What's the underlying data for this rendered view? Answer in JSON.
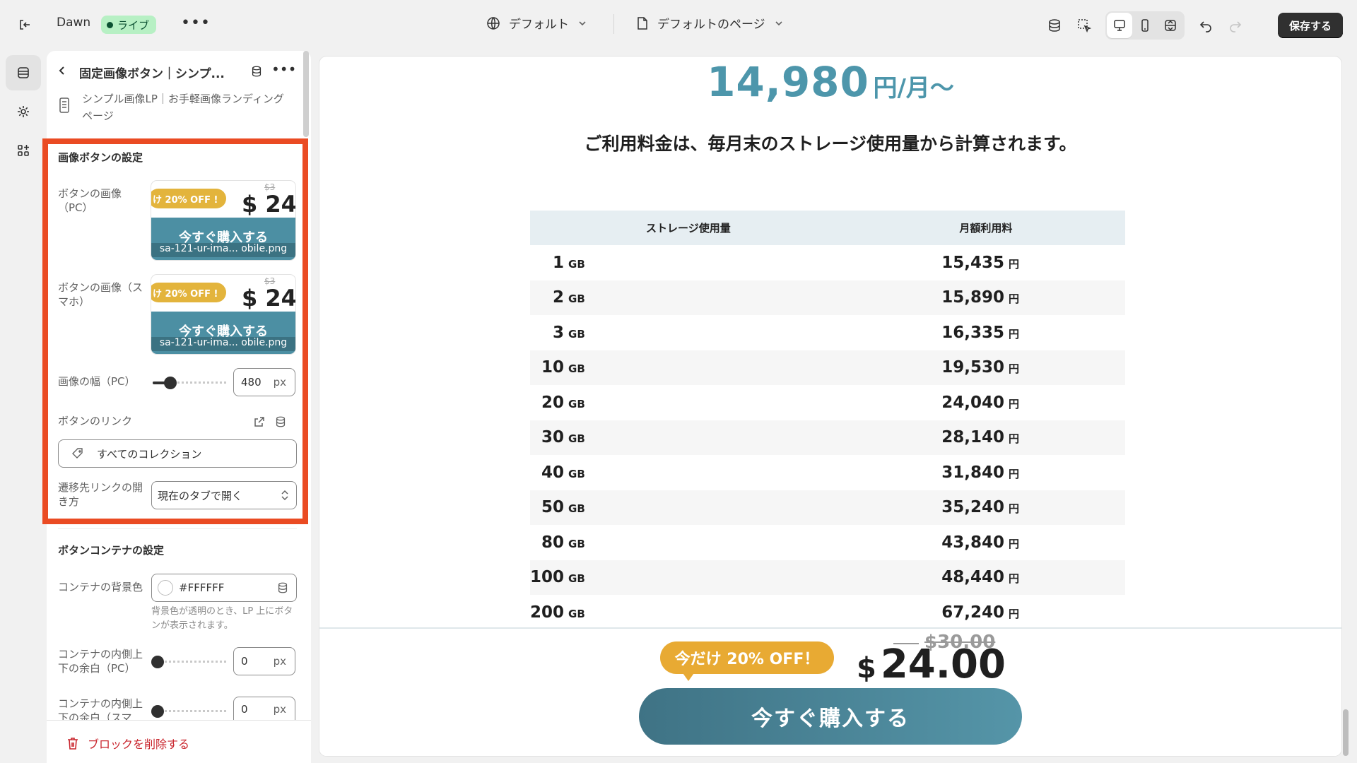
{
  "topbar": {
    "store_name": "Dawn",
    "live_badge": "ライブ",
    "more": "•••",
    "theme_label": "デフォルト",
    "page_label": "デフォルトのページ",
    "save_label": "保存する"
  },
  "panel": {
    "title": "固定画像ボタン｜シンプ...",
    "subtitle": "シンプル画像LP｜お手軽画像ランディングページ",
    "section_image_button": "画像ボタンの設定",
    "image_pc_label": "ボタンの画像（PC）",
    "image_sp_label": "ボタンの画像（スマホ）",
    "thumb_pc": {
      "badge": "け 20% OFF !",
      "strike": "$3",
      "price": "$ 24.",
      "buy": "今すぐ購入する",
      "filename": "sa-121-ur-ima... obile.png"
    },
    "thumb_sp": {
      "badge": "け 20% OFF !",
      "strike": "$3",
      "price": "$ 24.",
      "buy": "今すぐ購入する",
      "filename": "sa-121-ur-ima... obile.png"
    },
    "width_pc_label": "画像の幅（PC）",
    "width_pc_value": "480",
    "width_pc_fraction": 0.2,
    "unit_px": "px",
    "link_label": "ボタンのリンク",
    "link_value": "すべてのコレクション",
    "open_label": "遷移先リンクの開き方",
    "open_value": "現在のタブで開く",
    "section_container": "ボタンコンテナの設定",
    "bg_label": "コンテナの背景色",
    "bg_value": "#FFFFFF",
    "bg_help": "背景色が透明のとき、LP 上にボタンが表示されます。",
    "pad_pc_label": "コンテナの内側上下の余白（PC）",
    "pad_pc_value": "0",
    "pad_sp_label": "コンテナの内側上下の余白（スマ",
    "pad_sp_value": "0",
    "delete_label": "ブロックを削除する"
  },
  "preview": {
    "price_num": "14,980",
    "price_unit": "円/月〜",
    "subhead": "ご利用料金は、毎月末のストレージ使用量から計算されます。",
    "table": {
      "headers": [
        "ストレージ使用量",
        "月額利用料"
      ],
      "rows": [
        {
          "gb": "1",
          "gb_unit": "GB",
          "fee": "15,435",
          "fee_unit": "円"
        },
        {
          "gb": "2",
          "gb_unit": "GB",
          "fee": "15,890",
          "fee_unit": "円"
        },
        {
          "gb": "3",
          "gb_unit": "GB",
          "fee": "16,335",
          "fee_unit": "円"
        },
        {
          "gb": "10",
          "gb_unit": "GB",
          "fee": "19,530",
          "fee_unit": "円"
        },
        {
          "gb": "20",
          "gb_unit": "GB",
          "fee": "24,040",
          "fee_unit": "円"
        },
        {
          "gb": "30",
          "gb_unit": "GB",
          "fee": "28,140",
          "fee_unit": "円"
        },
        {
          "gb": "40",
          "gb_unit": "GB",
          "fee": "31,840",
          "fee_unit": "円"
        },
        {
          "gb": "50",
          "gb_unit": "GB",
          "fee": "35,240",
          "fee_unit": "円"
        },
        {
          "gb": "80",
          "gb_unit": "GB",
          "fee": "43,840",
          "fee_unit": "円"
        },
        {
          "gb": "100",
          "gb_unit": "GB",
          "fee": "48,440",
          "fee_unit": "円"
        },
        {
          "gb": "200",
          "gb_unit": "GB",
          "fee": "67,240",
          "fee_unit": "円"
        }
      ]
    },
    "sticky": {
      "badge": "今だけ 20% OFF！",
      "strike_price": "$30.00",
      "currency": "$",
      "price": "24.00",
      "buy_label": "今すぐ購入する"
    }
  },
  "colors": {
    "highlight": "#ea4b23",
    "accent_price": "#4d96ab",
    "badge": "#e8aa33",
    "buy_button": "#4b8799",
    "live_badge_bg": "#b7f0c4"
  }
}
